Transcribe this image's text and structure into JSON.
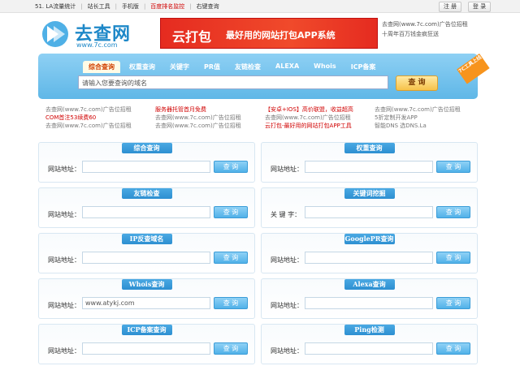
{
  "topbar": {
    "links": [
      {
        "label": "51. LA流量统计",
        "red": false
      },
      {
        "label": "站长工具",
        "red": false
      },
      {
        "label": "手机版",
        "red": false
      },
      {
        "label": "百度排名监控",
        "red": true
      },
      {
        "label": "右键查询",
        "red": false
      }
    ],
    "register_label": "注 册",
    "login_label": "登 录"
  },
  "logo": {
    "text": "去查网",
    "sub": "www.7c.com"
  },
  "banner": {
    "main": "云打包",
    "sub": "最好用的网站打包APP系统"
  },
  "right_ad": {
    "line1": "去查网(www.7c.com)广告位招租",
    "line2": "十周年百万钱金疯狂送"
  },
  "search": {
    "tabs": [
      "综合查询",
      "权重查询",
      "关键字",
      "PR值",
      "友链检查",
      "ALEXA",
      "Whois",
      "ICP备案"
    ],
    "active_tab": 0,
    "placeholder": "请输入您要查询的域名",
    "button": "查 询",
    "ribbon": "7C工具上线"
  },
  "ads": [
    [
      {
        "t": "去查网(www.7c.com)广告位招租",
        "r": false
      },
      {
        "t": "服务器托管首月免费",
        "r": true
      },
      {
        "t": "【安卓+IOS】高价联盟，收益超高",
        "r": true
      },
      {
        "t": "去查网(www.7c.com)广告位招租",
        "r": false
      }
    ],
    [
      {
        "t": "COM首注53续费60",
        "r": true
      },
      {
        "t": "去查网(www.7c.com)广告位招租",
        "r": false
      },
      {
        "t": "去查网(www.7c.com)广告位招租",
        "r": false
      },
      {
        "t": "5折定制开发APP",
        "r": false
      }
    ],
    [
      {
        "t": "去查网(www.7c.com)广告位招租",
        "r": false
      },
      {
        "t": "去查网(www.7c.com)广告位招租",
        "r": false
      },
      {
        "t": "云打包-最好用的网站打包APP工具",
        "r": true
      },
      {
        "t": "智能DNS 选DNS.La",
        "r": false
      }
    ]
  ],
  "panels": [
    {
      "title": "综合查询",
      "label": "网站地址：",
      "value": "",
      "button": "查 询"
    },
    {
      "title": "权重查询",
      "label": "网站地址：",
      "value": "",
      "button": "查 询"
    },
    {
      "title": "友链检查",
      "label": "网站地址：",
      "value": "",
      "button": "查 询"
    },
    {
      "title": "关键词挖掘",
      "label": "关 键 字：",
      "value": "",
      "button": "查 询"
    },
    {
      "title": "IP反查域名",
      "label": "网站地址：",
      "value": "",
      "button": "查 询"
    },
    {
      "title": "GooglePR查询",
      "label": "网站地址：",
      "value": "",
      "button": "查 询"
    },
    {
      "title": "Whois查询",
      "label": "网站地址：",
      "value": "www.atykj.com",
      "button": "查 询"
    },
    {
      "title": "Alexa查询",
      "label": "网站地址：",
      "value": "",
      "button": "查 询"
    },
    {
      "title": "ICP备案查询",
      "label": "网站地址：",
      "value": "",
      "button": "查 询"
    },
    {
      "title": "Ping检测",
      "label": "网站地址：",
      "value": "",
      "button": "查 询"
    }
  ]
}
